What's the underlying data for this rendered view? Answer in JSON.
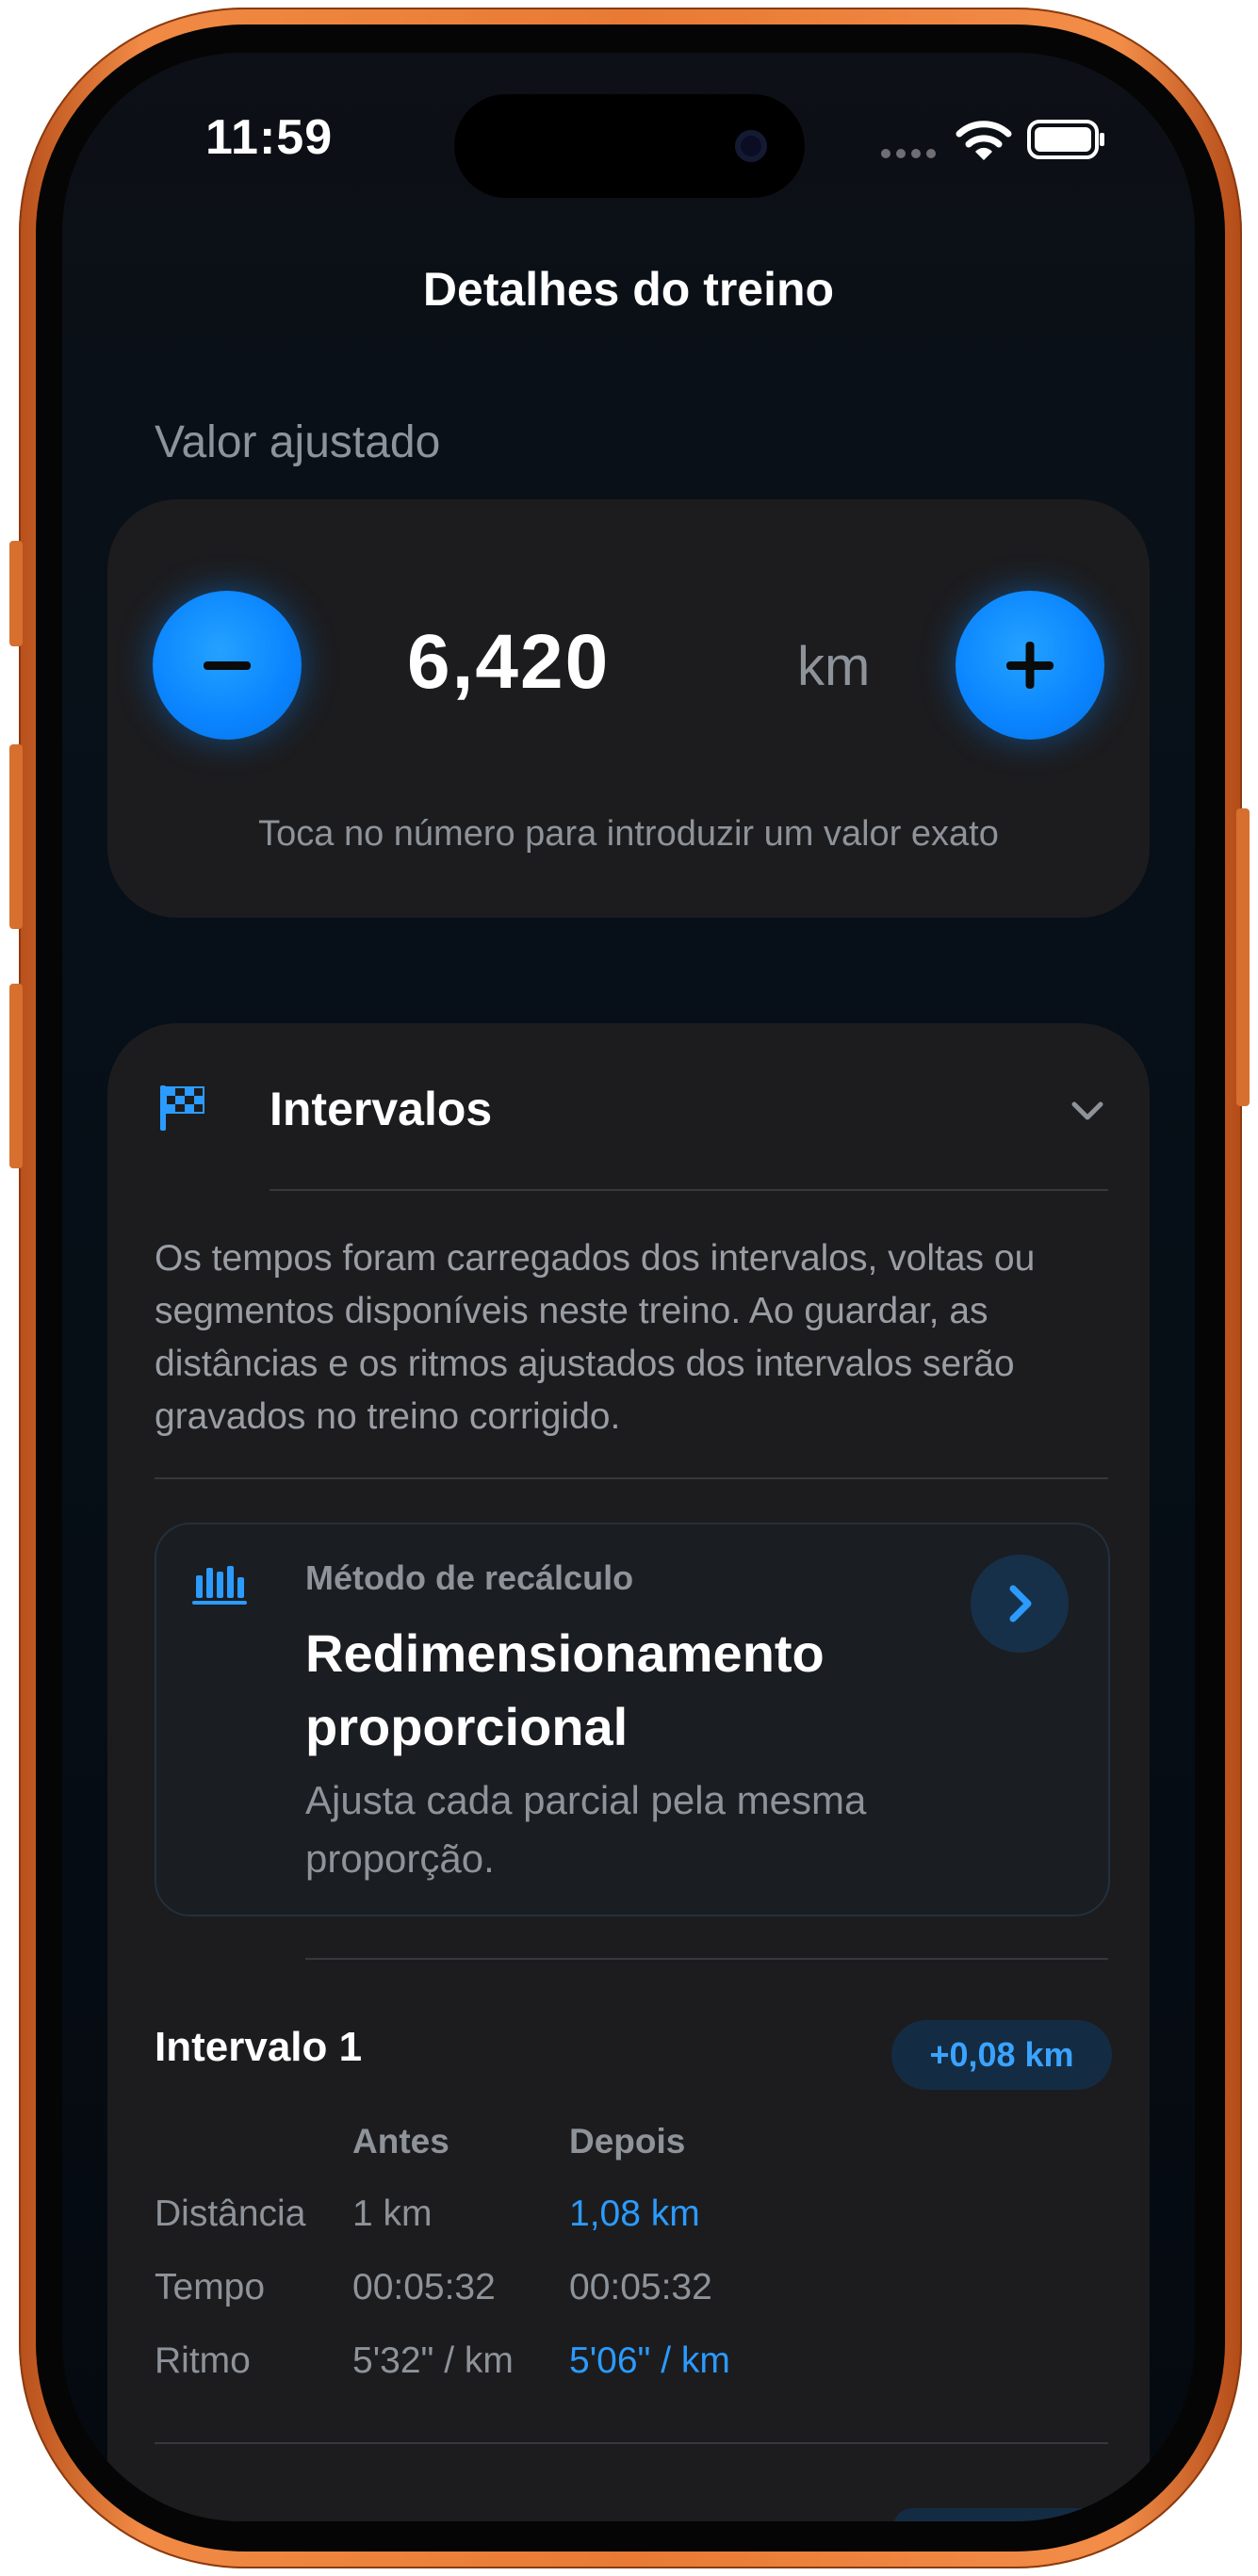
{
  "status_bar": {
    "time": "11:59"
  },
  "header": {
    "title": "Detalhes do treino"
  },
  "adjusted": {
    "label": "Valor ajustado",
    "value": "6,420",
    "unit": "km",
    "hint": "Toca no número para introduzir um valor exato"
  },
  "intervals": {
    "title": "Intervalos",
    "description": "Os tempos foram carregados dos intervalos, voltas ou segmentos disponíveis neste treino. Ao guardar, as distâncias e os ritmos ajustados dos intervalos serão gravados no treino corrigido.",
    "method": {
      "caption": "Método de recálculo",
      "title": "Redimensionamento proporcional",
      "description": "Ajusta cada parcial pela mesma proporção."
    },
    "interval1": {
      "title": "Intervalo 1",
      "badge": "+0,08 km",
      "headers": {
        "before": "Antes",
        "after": "Depois"
      },
      "rows": [
        {
          "label": "Distância",
          "before": "1 km",
          "after": "1,08 km"
        },
        {
          "label": "Tempo",
          "before": "00:05:32",
          "after": "00:05:32"
        },
        {
          "label": "Ritmo",
          "before": "5'32\" / km",
          "after": "5'06\" / km"
        }
      ]
    }
  },
  "colors": {
    "accent": "#0a84ff",
    "frame": "#e87a34",
    "card": "#1c1c1e"
  }
}
